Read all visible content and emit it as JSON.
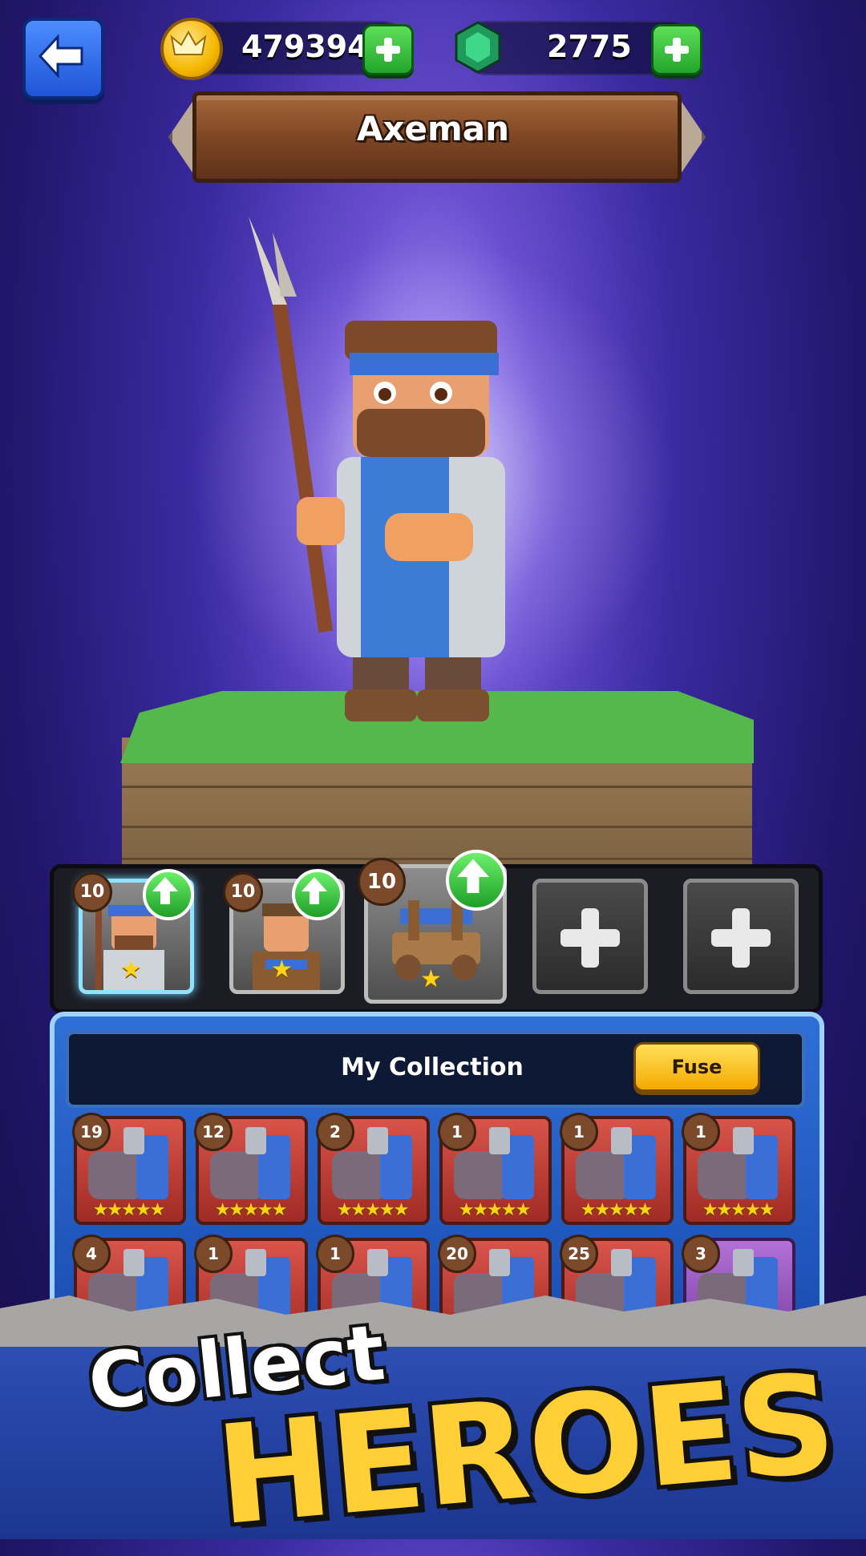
{
  "currencies": {
    "coins": "479394",
    "gems": "2775"
  },
  "hero": {
    "name": "Axeman"
  },
  "team": [
    {
      "level": "10",
      "stars": "★",
      "upgrade": true
    },
    {
      "level": "10",
      "stars": "★",
      "upgrade": true
    },
    {
      "level": "10",
      "stars": "★",
      "upgrade": true
    },
    {
      "empty": true
    },
    {
      "empty": true
    }
  ],
  "collection": {
    "title": "My Collection",
    "fuse_label": "Fuse",
    "cards": [
      {
        "count": "19",
        "stars": "★★★★★"
      },
      {
        "count": "12",
        "stars": "★★★★★"
      },
      {
        "count": "2",
        "stars": "★★★★★"
      },
      {
        "count": "1",
        "stars": "★★★★★"
      },
      {
        "count": "1",
        "stars": "★★★★★"
      },
      {
        "count": "1",
        "stars": "★★★★★"
      },
      {
        "count": "4",
        "stars": ""
      },
      {
        "count": "1",
        "stars": ""
      },
      {
        "count": "1",
        "stars": ""
      },
      {
        "count": "20",
        "stars": ""
      },
      {
        "count": "25",
        "stars": ""
      },
      {
        "count": "3",
        "stars": ""
      }
    ]
  },
  "promo": {
    "line1": "Collect",
    "line2": "HEROES"
  },
  "colors": {
    "background": "#2a1c86",
    "accent_green": "#21a52a",
    "accent_gold": "#ffcf35"
  }
}
